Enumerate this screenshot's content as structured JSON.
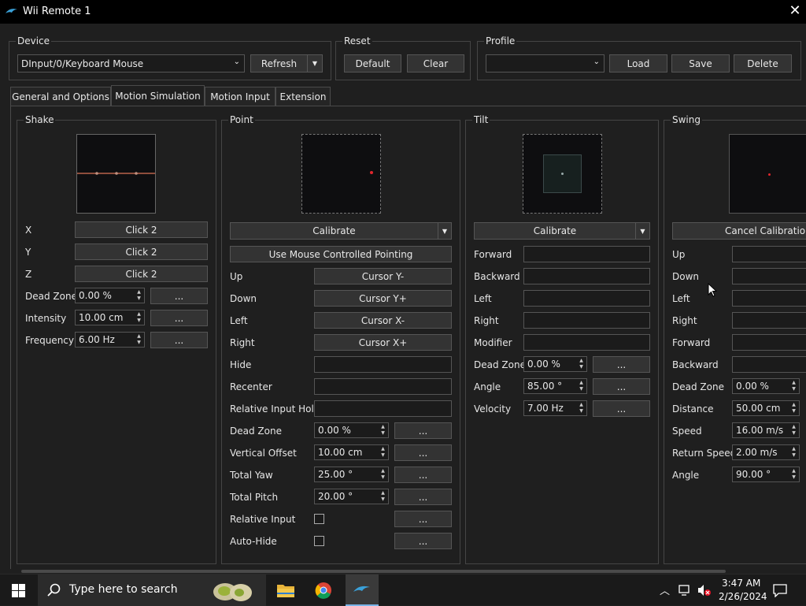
{
  "window": {
    "title": "Wii Remote 1"
  },
  "device": {
    "group": "Device",
    "value": "DInput/0/Keyboard Mouse",
    "refresh": "Refresh"
  },
  "reset": {
    "group": "Reset",
    "default": "Default",
    "clear": "Clear"
  },
  "profile": {
    "group": "Profile",
    "value": "",
    "load": "Load",
    "save": "Save",
    "delete": "Delete"
  },
  "tabs": [
    "General and Options",
    "Motion Simulation",
    "Motion Input",
    "Extension"
  ],
  "shake": {
    "title": "Shake",
    "x": {
      "label": "X",
      "value": "Click 2"
    },
    "y": {
      "label": "Y",
      "value": "Click 2"
    },
    "z": {
      "label": "Z",
      "value": "Click 2"
    },
    "dead_zone": {
      "label": "Dead Zone",
      "value": "0.00 %"
    },
    "intensity": {
      "label": "Intensity",
      "value": "10.00 cm"
    },
    "frequency": {
      "label": "Frequency",
      "value": "6.00 Hz"
    }
  },
  "point": {
    "title": "Point",
    "calibrate": "Calibrate",
    "mouse_pointing": "Use Mouse Controlled Pointing",
    "up": {
      "label": "Up",
      "value": "Cursor Y-"
    },
    "down": {
      "label": "Down",
      "value": "Cursor Y+"
    },
    "left": {
      "label": "Left",
      "value": "Cursor X-"
    },
    "right": {
      "label": "Right",
      "value": "Cursor X+"
    },
    "hide": "Hide",
    "recenter": "Recenter",
    "relative_hold": "Relative Input Hold",
    "dead_zone": {
      "label": "Dead Zone",
      "value": "0.00 %"
    },
    "vertical_offset": {
      "label": "Vertical Offset",
      "value": "10.00 cm"
    },
    "total_yaw": {
      "label": "Total Yaw",
      "value": "25.00 °"
    },
    "total_pitch": {
      "label": "Total Pitch",
      "value": "20.00 °"
    },
    "relative_input": "Relative Input",
    "auto_hide": "Auto-Hide"
  },
  "tilt": {
    "title": "Tilt",
    "calibrate": "Calibrate",
    "forward": "Forward",
    "backward": "Backward",
    "left": "Left",
    "right": "Right",
    "modifier": "Modifier",
    "dead_zone": {
      "label": "Dead Zone",
      "value": "0.00 %"
    },
    "angle": {
      "label": "Angle",
      "value": "85.00 °"
    },
    "velocity": {
      "label": "Velocity",
      "value": "7.00 Hz"
    }
  },
  "swing": {
    "title": "Swing",
    "cancel": "Cancel Calibration",
    "up": "Up",
    "down": "Down",
    "left": "Left",
    "right": "Right",
    "forward": "Forward",
    "backward": "Backward",
    "dead_zone": {
      "label": "Dead Zone",
      "value": "0.00 %"
    },
    "distance": {
      "label": "Distance",
      "value": "50.00 cm"
    },
    "speed": {
      "label": "Speed",
      "value": "16.00 m/s"
    },
    "return_speed": {
      "label": "Return Speed",
      "value": "2.00 m/s"
    },
    "angle": {
      "label": "Angle",
      "value": "90.00 °"
    }
  },
  "common": {
    "more": "..."
  },
  "taskbar": {
    "search_placeholder": "Type here to search",
    "time": "3:47 AM",
    "date": "2/26/2024"
  },
  "colors": {
    "accent": "#e0262c",
    "line": "#b8644a"
  }
}
